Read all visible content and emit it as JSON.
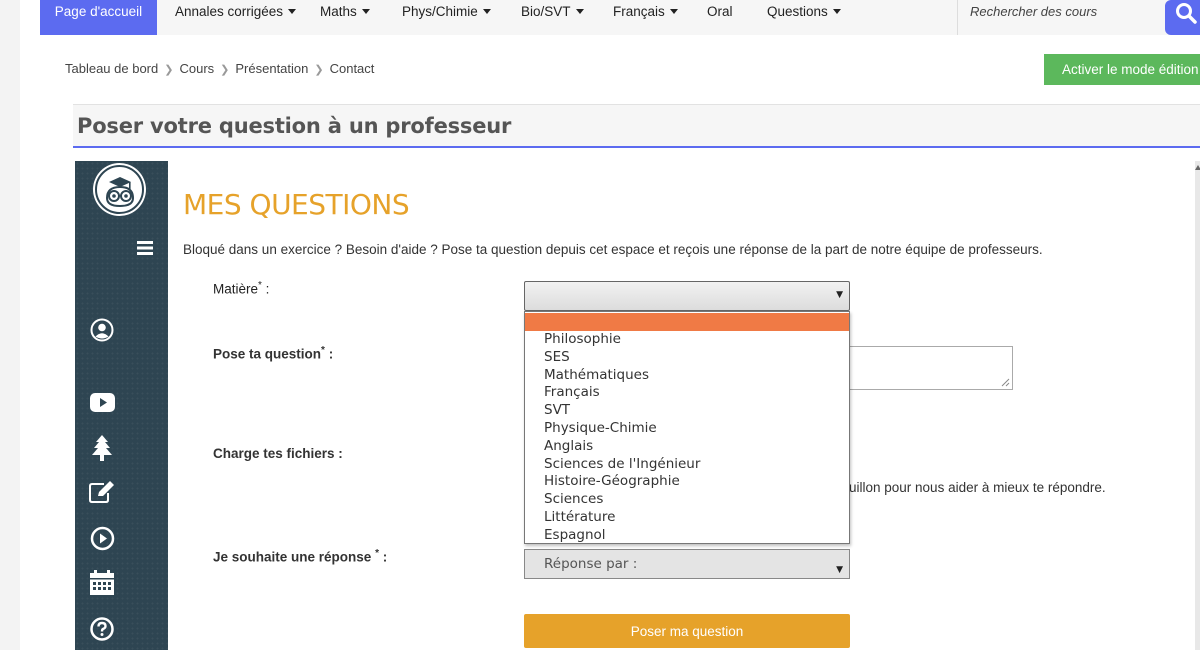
{
  "nav": {
    "home": "Page d'accueil",
    "items": [
      {
        "label": "Annales corrigées",
        "dropdown": true
      },
      {
        "label": "Maths",
        "dropdown": true
      },
      {
        "label": "Phys/Chimie",
        "dropdown": true
      },
      {
        "label": "Bio/SVT",
        "dropdown": true
      },
      {
        "label": "Français",
        "dropdown": true
      },
      {
        "label": "Oral",
        "dropdown": false
      },
      {
        "label": "Questions",
        "dropdown": true
      }
    ],
    "search_placeholder": "Rechercher des cours",
    "accent_color": "#5c6bf0"
  },
  "breadcrumb": [
    "Tableau de bord",
    "Cours",
    "Présentation",
    "Contact"
  ],
  "edit_button": "Activer le mode édition",
  "page_title": "Poser votre question à un professeur",
  "sidebar": {
    "icons": [
      "menu-icon",
      "user-icon",
      "youtube-icon",
      "tree-icon",
      "edit-icon",
      "play-icon",
      "calendar-icon",
      "help-icon"
    ]
  },
  "main": {
    "heading": "MES QUESTIONS",
    "intro": "Bloqué dans un exercice ? Besoin d'aide ? Pose ta question depuis cet espace et reçois une réponse de la part de notre équipe de professeurs.",
    "heading_color": "#e6a22a"
  },
  "form": {
    "matiere_label": "Matière",
    "question_label": "Pose ta question",
    "files_label": "Charge tes fichiers :",
    "files_help_partial": "uillon pour nous aider à mieux te répondre.",
    "reply_label": "Je souhaite une réponse",
    "reply_value": "Réponse par :",
    "submit_label": "Poser ma question",
    "required_mark": "*",
    "colon": " :"
  },
  "dropdown": {
    "highlight_color": "#f07a45",
    "options": [
      "Philosophie",
      "SES",
      "Mathématiques",
      "Français",
      "SVT",
      "Physique-Chimie",
      "Anglais",
      "Sciences de l'Ingénieur",
      "Histoire-Géographie",
      "Sciences",
      "Littérature",
      "Espagnol"
    ]
  }
}
